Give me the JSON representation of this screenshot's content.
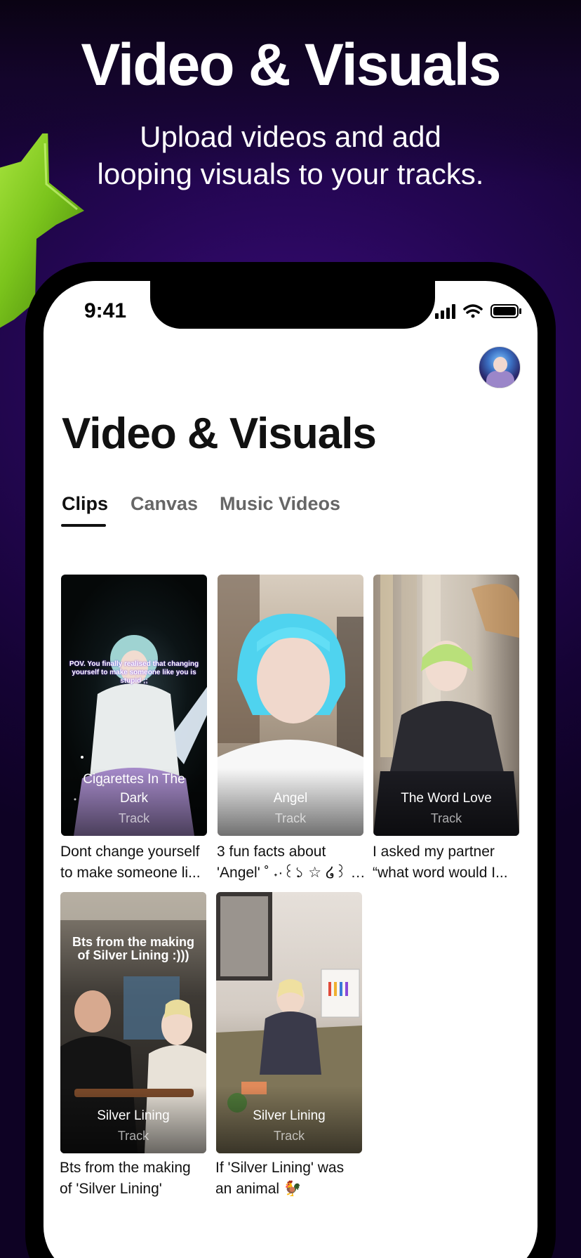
{
  "promo": {
    "headline": "Video & Visuals",
    "subheadline": "Upload videos and add\nlooping visuals to your tracks."
  },
  "status_bar": {
    "time": "9:41"
  },
  "screen": {
    "title": "Video & Visuals",
    "tabs": [
      {
        "label": "Clips",
        "active": true
      },
      {
        "label": "Canvas",
        "active": false
      },
      {
        "label": "Music Videos",
        "active": false
      }
    ]
  },
  "clips": [
    {
      "overlay_text": "POV. You finally realised that changing yourself to make someone like you is stupid ;;",
      "title": "Cigarettes In The Dark",
      "type": "Track",
      "caption_line1": "Dont change yourself",
      "caption_line2": "to make someone li..."
    },
    {
      "title": "Angel",
      "type": "Track",
      "caption_line1": "3 fun facts about",
      "caption_line2": "'Angel' ˚ ˖·꒰১ ☆ ໒꒱ ·˖ ˚"
    },
    {
      "title": "The Word Love",
      "type": "Track",
      "caption_line1": "I asked my partner",
      "caption_line2": "“what word would I..."
    },
    {
      "overlay_text": "Bts from the making of Silver Lining :)))",
      "title": "Silver Lining",
      "type": "Track",
      "caption_line1": "Bts from the making",
      "caption_line2": "of 'Silver Lining'"
    },
    {
      "title": "Silver Lining",
      "type": "Track",
      "caption_line1": "If 'Silver Lining' was",
      "caption_line2": "an animal 🐓"
    }
  ],
  "icons": [
    "signal-icon",
    "wifi-icon",
    "battery-icon",
    "avatar"
  ],
  "colors": {
    "background": "#22064f",
    "accent_star": "#7bc41c",
    "screen": "#ffffff",
    "text": "#111111"
  }
}
